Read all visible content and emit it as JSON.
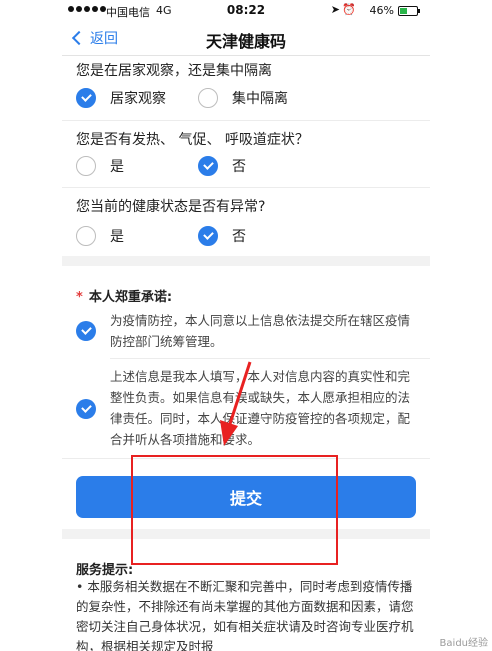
{
  "statusbar": {
    "carrier": "中国电信",
    "network": "4G",
    "time": "08:22",
    "battery_pct": "46%",
    "battery_level": 0.46
  },
  "nav": {
    "back_label": "返回",
    "title": "天津健康码"
  },
  "questions": [
    {
      "text": "您是在居家观察，还是集中隔离",
      "options": [
        {
          "label": "居家观察",
          "checked": true
        },
        {
          "label": "集中隔离",
          "checked": false
        }
      ]
    },
    {
      "text": "您是否有发热、 气促、 呼吸道症状？",
      "options": [
        {
          "label": "是",
          "checked": false
        },
        {
          "label": "否",
          "checked": true
        }
      ]
    },
    {
      "text": "您当前的健康状态是否有异常?",
      "options": [
        {
          "label": "是",
          "checked": false
        },
        {
          "label": "否",
          "checked": true
        }
      ]
    }
  ],
  "promise": {
    "required_mark": "*",
    "heading": "本人郑重承诺:",
    "items": [
      {
        "text": "为疫情防控，本人同意以上信息依法提交所在辖区疫情防控部门统筹管理。",
        "checked": true
      },
      {
        "text": "上述信息是我本人填写，本人对信息内容的真实性和完整性负责。如果信息有误或缺失，本人愿承担相应的法律责任。同时，本人保证遵守防疫管控的各项规定，配合并听从各项措施和要求。",
        "checked": true
      }
    ],
    "submit_label": "提交"
  },
  "service": {
    "heading": "服务提示:",
    "body": "• 本服务相关数据在不断汇聚和完善中，同时考虑到疫情传播的复杂性，不排除还有尚未掌握的其他方面数据和因素，请您密切关注自己身体状况，如有相关症状请及时咨询专业医疗机构，根据相关规定及时报"
  },
  "watermark": "Baidu经验",
  "colors": {
    "accent": "#2b7de9",
    "annotation": "#e82121"
  }
}
